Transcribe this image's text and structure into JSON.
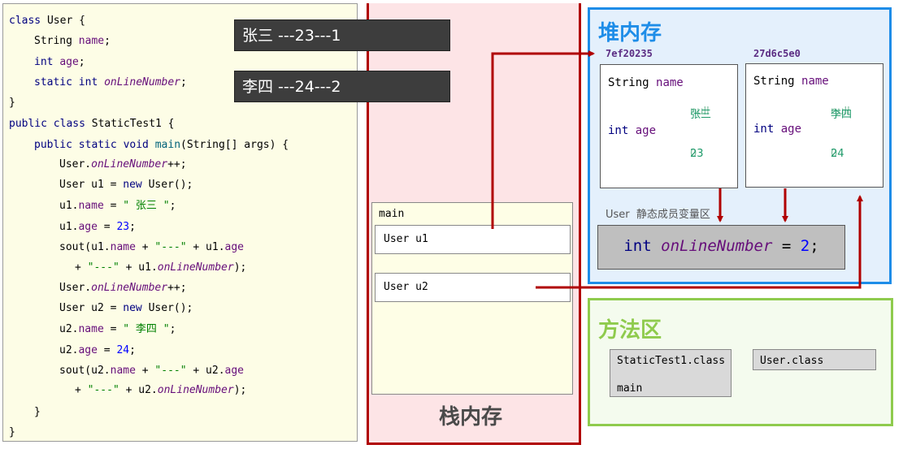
{
  "code": {
    "l1_a": "class",
    "l1_b": " User {",
    "l2_a": "String ",
    "l2_b": "name",
    "l2_c": ";",
    "l3_a": "int ",
    "l3_b": "age",
    "l3_c": ";",
    "l4_a": "static int ",
    "l4_b": "onLineNumber",
    "l4_c": ";",
    "l5": "}",
    "l6_a": "public class",
    "l6_b": " StaticTest1 {",
    "l7_a": "public static void ",
    "l7_b": "main",
    "l7_c": "(String[] args) {",
    "l8_a": "User.",
    "l8_b": "onLineNumber",
    "l8_c": "++;",
    "l9_a": "User u1 = ",
    "l9_b": "new",
    "l9_c": " User();",
    "l10_a": "u1.",
    "l10_b": "name",
    "l10_c": " = ",
    "l10_d": "\" 张三 \"",
    "l10_e": ";",
    "l11_a": "u1.",
    "l11_b": "age",
    "l11_c": " = ",
    "l11_d": "23",
    "l11_e": ";",
    "l12_a": "sout(u1.",
    "l12_b": "name",
    "l12_c": " + ",
    "l12_d": "\"---\"",
    "l12_e": " + u1.",
    "l12_f": "age",
    "l13_a": "+ ",
    "l13_b": "\"---\"",
    "l13_c": " + u1.",
    "l13_d": "onLineNumber",
    "l13_e": ");",
    "l14_a": "User.",
    "l14_b": "onLineNumber",
    "l14_c": "++;",
    "l15_a": "User u2 = ",
    "l15_b": "new",
    "l15_c": " User();",
    "l16_a": "u2.",
    "l16_b": "name",
    "l16_c": " = ",
    "l16_d": "\" 李四 \"",
    "l16_e": ";",
    "l17_a": "u2.",
    "l17_b": "age",
    "l17_c": " = ",
    "l17_d": "24",
    "l17_e": ";",
    "l18_a": "sout(u2.",
    "l18_b": "name",
    "l18_c": " + ",
    "l18_d": "\"---\"",
    "l18_e": " + u2.",
    "l18_f": "age",
    "l19_a": "+ ",
    "l19_b": "\"---\"",
    "l19_c": " + u2.",
    "l19_d": "onLineNumber",
    "l19_e": ");",
    "l20": "}",
    "l21": "}"
  },
  "output": {
    "line1": "张三 ---23---1",
    "line2": "李四 ---24---2"
  },
  "stack": {
    "title": "栈内存",
    "frame_name": "main",
    "var1": "User u1",
    "var2": "User u2"
  },
  "heap": {
    "title": "堆内存",
    "obj1": {
      "address": "7ef20235",
      "field1_type": "String ",
      "field1_name": "name",
      "field1_value_old": "null",
      "field1_value": "张三",
      "field2_type": "int ",
      "field2_name": "age",
      "field2_value_old": "0",
      "field2_value": "23"
    },
    "obj2": {
      "address": "27d6c5e0",
      "field1_type": "String ",
      "field1_name": "name",
      "field1_value_old": "null",
      "field1_value": "李四",
      "field2_type": "int ",
      "field2_name": "age",
      "field2_value_old": "0",
      "field2_value": "24"
    },
    "static_label": "User  静态成员变量区",
    "static_type": "int ",
    "static_name": "onLineNumber",
    "static_eq": " = ",
    "static_value": "2",
    "static_semi": ";"
  },
  "method_area": {
    "title": "方法区",
    "class1": "StaticTest1.class",
    "class1_method": "main",
    "class2": "User.class"
  },
  "colors": {
    "arrow": "#b00000",
    "heap_accent": "#1e8de8",
    "method_accent": "#8fcb4d"
  }
}
